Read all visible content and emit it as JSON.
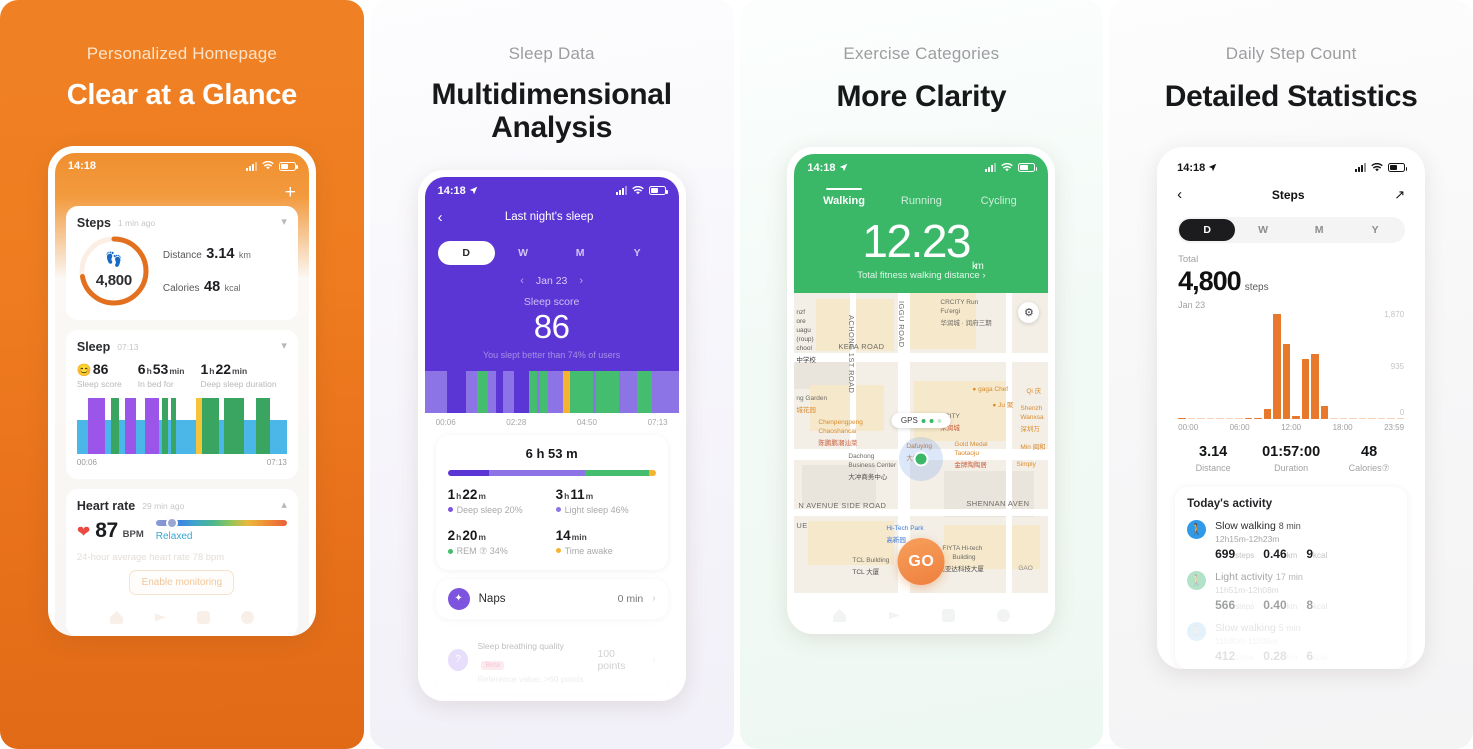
{
  "panels": [
    {
      "subtitle": "Personalized Homepage",
      "title": "Clear at a Glance",
      "status": {
        "time": "14:18"
      },
      "steps_card": {
        "title": "Steps",
        "updated": "1 min ago",
        "steps_value": "4,800",
        "distance_label": "Distance",
        "distance_value": "3.14",
        "distance_unit": "km",
        "calories_label": "Calories",
        "calories_value": "48",
        "calories_unit": "kcal",
        "ring_percent": 72,
        "ring_color": "#e2701f"
      },
      "sleep_card": {
        "title": "Sleep",
        "updated": "07:13",
        "score": "86",
        "score_label": "Sleep score",
        "inbed_h": "6",
        "inbed_hu": "h",
        "inbed_m": "53",
        "inbed_mu": "min",
        "inbed_label": "In bed for",
        "deep_h": "1",
        "deep_hu": "h",
        "deep_m": "22",
        "deep_mu": "min",
        "deep_label": "Deep sleep duration",
        "axis_start": "00:06",
        "axis_end": "07:13"
      },
      "heart_card": {
        "title": "Heart rate",
        "updated": "29 min ago",
        "bpm": "87",
        "bpm_unit": "BPM",
        "state": "Relaxed",
        "avg_note": "24-hour average heart rate 78 bpm",
        "enable_button": "Enable monitoring"
      }
    },
    {
      "subtitle": "Sleep Data",
      "title_line1": "Multidimensional",
      "title_line2": "Analysis",
      "status": {
        "time": "14:18"
      },
      "nav_title": "Last night's sleep",
      "tabs": [
        "D",
        "W",
        "M",
        "Y"
      ],
      "active_tab": "D",
      "date": "Jan 23",
      "score_label": "Sleep score",
      "score": "86",
      "score_note": "You slept better than 74% of users",
      "axis": [
        "00:06",
        "02:28",
        "04:50",
        "07:13"
      ],
      "summary": {
        "total": "6 h 53 m",
        "deep_h": "1",
        "deep_m": "22",
        "deep_label": "Deep sleep 20%",
        "light_h": "3",
        "light_m": "11",
        "light_label": "Light sleep 46%",
        "rem_h": "2",
        "rem_m": "20",
        "rem_label": "REM ⑦ 34%",
        "awake_m": "14",
        "awake_mu": "min",
        "awake_label": "Time awake"
      },
      "naps": {
        "label": "Naps",
        "value": "0 min"
      },
      "breathing": {
        "label": "Sleep breathing quality",
        "badge": "Beta",
        "value": "100 points",
        "reference": "Reference value: >60 points"
      }
    },
    {
      "subtitle": "Exercise Categories",
      "title": "More Clarity",
      "status": {
        "time": "14:18"
      },
      "tabs": [
        "Walking",
        "Running",
        "Cycling"
      ],
      "active_tab": "Walking",
      "distance": "12.23",
      "distance_unit": "km",
      "distance_caption": "Total fitness walking distance",
      "gps_label": "GPS",
      "go_button": "GO",
      "map_labels": [
        "ACHONG 1ST ROAD",
        "IGGU ROAD",
        "KEFA ROAD",
        "N AVENUE SIDE ROAD",
        "SHENNAN AVEN",
        "UE",
        "GAO"
      ],
      "map_pois": [
        "CRCITY Run",
        "Fu'ergi 华润城 · 润府三期",
        "gaga Chef",
        "Ju 聚",
        "Shenzh Wanxsa 深圳万",
        "Chenpengpeng Chaoshancai 陈鹏鹏潮汕菜",
        "Gold Medal Taotaoju 金牌陶陶居",
        "Simply 星",
        "Min 闽和",
        "Dachong Business Center 大冲商务中心",
        "Hi-Tech Park 高新园",
        "TCL Building TCL 大厦",
        "FIYTA Hi-tech Building 飞亚达科技大厦",
        "Dafuying 大福开",
        "ng Garden 城花园",
        "nzf ore uagu (roup) chool 中学校",
        "Qi 庆"
      ]
    },
    {
      "subtitle": "Daily Step Count",
      "title": "Detailed Statistics",
      "status": {
        "time": "14:18"
      },
      "nav_title": "Steps",
      "tabs": [
        "D",
        "W",
        "M",
        "Y"
      ],
      "active_tab": "D",
      "total_label": "Total",
      "total_value": "4,800",
      "total_unit": "steps",
      "date": "Jan 23",
      "summary": {
        "distance_value": "3.14",
        "distance_label": "Distance",
        "duration_value": "01:57:00",
        "duration_label": "Duration",
        "calories_value": "48",
        "calories_label": "Calories⑦"
      },
      "activity": {
        "heading": "Today's activity",
        "rows": [
          {
            "name": "Slow walking",
            "duration": "8 min",
            "range": "12h15m-12h23m",
            "steps": "699",
            "steps_unit": "steps",
            "km": "0.46",
            "km_unit": "km",
            "kcal": "9",
            "kcal_unit": "kcal",
            "color": "#2f9ae8"
          },
          {
            "name": "Light activity",
            "duration": "17 min",
            "range": "11h51m-12h08m",
            "steps": "566",
            "steps_unit": "steps",
            "km": "0.40",
            "km_unit": "km",
            "kcal": "8",
            "kcal_unit": "kcal",
            "color": "#49bb7c"
          },
          {
            "name": "Slow walking",
            "duration": "5 min",
            "range": "11h30m-11h35m",
            "steps": "412",
            "steps_unit": "steps",
            "km": "0.28",
            "km_unit": "km",
            "kcal": "6",
            "kcal_unit": "kcal",
            "color": "#2f9ae8"
          }
        ]
      }
    }
  ],
  "chart_data": [
    {
      "type": "bar",
      "title": "Sleep stages (home card)",
      "panel": 1,
      "categories": [
        "00:06",
        "",
        "",
        "",
        "",
        "",
        "",
        "",
        "",
        "",
        "",
        "",
        "",
        "",
        "",
        "07:13"
      ],
      "values": [
        100,
        100,
        100,
        100,
        100,
        100,
        100,
        100,
        100,
        100,
        100,
        100,
        100,
        100,
        100,
        100
      ],
      "stages": [
        "light",
        "deep",
        "rem",
        "light",
        "deep",
        "light",
        "deep",
        "light",
        "deep",
        "rem",
        "light",
        "awake",
        "rem",
        "light",
        "rem",
        "light",
        "rem",
        "light"
      ],
      "colors": {
        "light": "#4ab7e8",
        "deep": "#9b55e8",
        "rem": "#3aa560",
        "awake": "#f5c43a"
      },
      "xlabel": "",
      "ylabel": ""
    },
    {
      "type": "bar",
      "title": "Sleep stages (detail hypnogram)",
      "panel": 2,
      "xlabel": "",
      "ylabel": "",
      "ticks": [
        "00:06",
        "02:28",
        "04:50",
        "07:13"
      ],
      "colors": {
        "light": "#8c73e6",
        "deep": "#5b36d4",
        "rem": "#45bd6e",
        "awake": "#f5b32f"
      }
    },
    {
      "type": "bar",
      "title": "Daily Step Count",
      "panel": 4,
      "categories": [
        "00:00",
        "",
        "",
        "",
        "06:00",
        "",
        "",
        "",
        "",
        "",
        "12:00",
        "",
        "",
        "18:00",
        "",
        "",
        "23:59"
      ],
      "x_ticks": [
        "00:00",
        "06:00",
        "12:00",
        "18:00",
        "23:59"
      ],
      "values": [
        10,
        0,
        0,
        0,
        0,
        0,
        0,
        10,
        5,
        180,
        0,
        0,
        0,
        0,
        0,
        0,
        0
      ],
      "bar_values": [
        8,
        0,
        0,
        0,
        0,
        8,
        4,
        175,
        0,
        0,
        0,
        0,
        0,
        0,
        0,
        0,
        0
      ],
      "series": [
        {
          "name": "Steps per interval",
          "values": [
            9,
            0,
            0,
            0,
            0,
            0,
            0,
            9,
            5,
            180,
            1870,
            1340,
            60,
            1060,
            1150,
            240,
            0,
            0,
            0,
            0,
            0,
            0,
            0,
            0
          ]
        }
      ],
      "ylim": [
        0,
        1870
      ],
      "y_ticks": [
        0,
        935,
        1870
      ],
      "y_tick_labels": [
        "0",
        "935",
        "1,870"
      ],
      "bar_color": "#e8792c",
      "xlabel": "",
      "ylabel": ""
    }
  ]
}
